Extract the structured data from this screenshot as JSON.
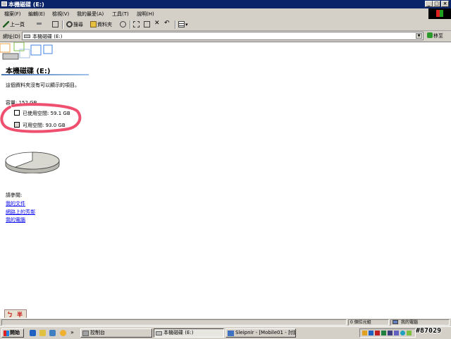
{
  "window": {
    "title": "本機磁碟 (E:)",
    "controls": [
      "_",
      "□",
      "×"
    ]
  },
  "menubar": {
    "items": [
      "檔案(F)",
      "編輯(E)",
      "檢視(V)",
      "我的最愛(A)",
      "工具(T)",
      "說明(H)"
    ]
  },
  "toolbar": {
    "back_label": "上一頁",
    "search_label": "搜尋",
    "folders_label": "資料夾",
    "icons": [
      "back-arrow",
      "forward-arrow",
      "up-folder",
      "search",
      "folders",
      "history",
      "move-to",
      "copy-to",
      "delete",
      "undo",
      "views"
    ]
  },
  "address": {
    "label": "網址(D)",
    "value": "本機磁碟 (E:)",
    "go_label": "移至"
  },
  "drive": {
    "title": "本機磁碟 (E:)",
    "empty_message": "這個資料夾沒有可以顯示的項目。",
    "capacity": "容量: 152 GB",
    "used_label": "已使用空間: 59.1 GB",
    "free_label": "可用空間: 93.0 GB",
    "used_fraction": 0.389,
    "colors": {
      "used": "#ffffff",
      "free": "#d8d8d0",
      "highlight": "#f05070"
    }
  },
  "see_also": {
    "heading": "請參閱:",
    "links": [
      "我的文件",
      "網路上的芳鄰",
      "我的電腦"
    ]
  },
  "ime": {
    "chars": [
      "ㄅ",
      "半"
    ]
  },
  "statusbar": {
    "left": "",
    "objects": "0 個位元組",
    "location": "我的電腦"
  },
  "taskbar": {
    "start_label": "開始",
    "tasks": [
      {
        "label": "控制台",
        "active": false
      },
      {
        "label": "本機磁碟 (E:)",
        "active": true
      },
      {
        "label": "Sleipnir - [Mobile01 - 討論...",
        "active": false
      }
    ]
  },
  "watermark": "#87029"
}
